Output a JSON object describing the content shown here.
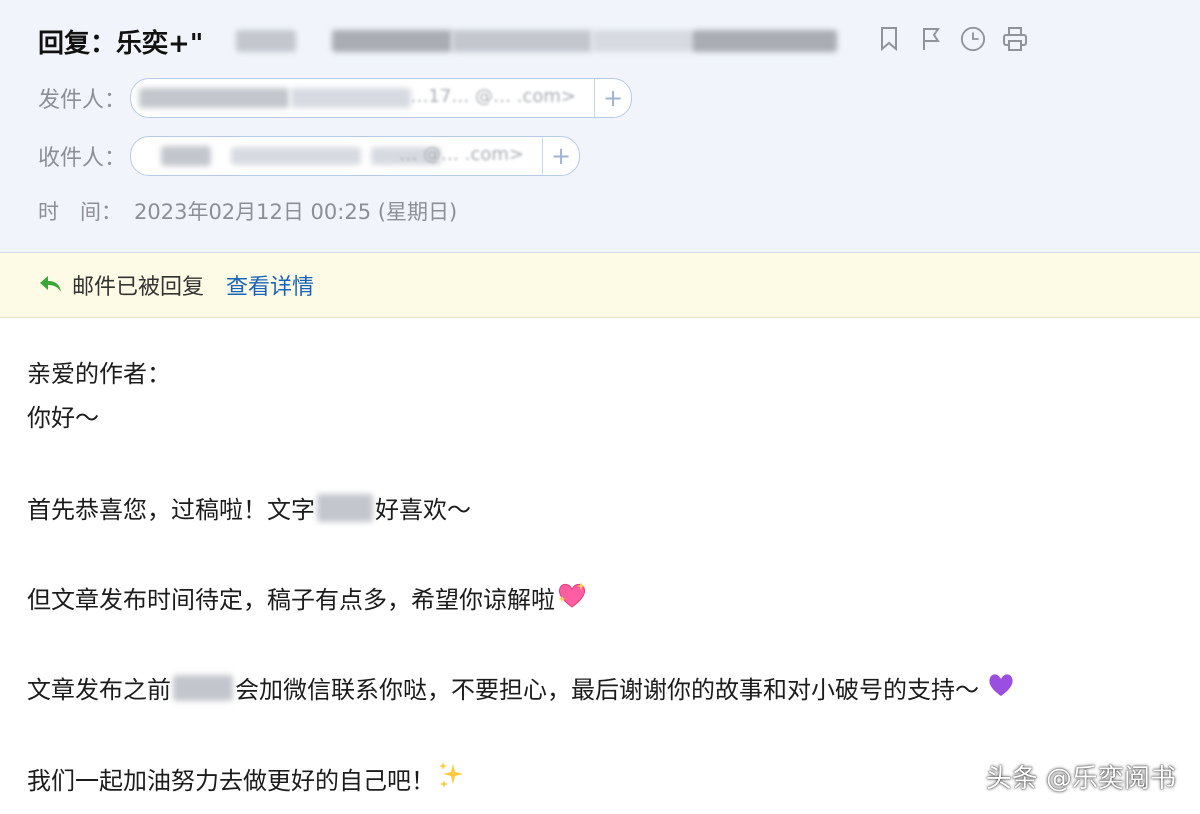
{
  "subject": {
    "prefix": "回复：乐奕+\""
  },
  "sender": {
    "label": "发件人：",
    "address_suffix": "…17… @… .com>"
  },
  "recipient": {
    "label": "收件人：",
    "address_suffix": "… @… .com>"
  },
  "add_symbol": "+",
  "time": {
    "label": "时　间：",
    "value": "2023年02月12日 00:25 (星期日)"
  },
  "actions": {
    "icons": [
      "bookmark-icon",
      "flag-icon",
      "clock-icon",
      "print-icon"
    ]
  },
  "replied_bar": {
    "status": "邮件已被回复",
    "details_link": "查看详情"
  },
  "body": {
    "greeting": "亲爱的作者：",
    "hello": "你好～",
    "p1_a": "首先恭喜您，过稿啦！文字",
    "p1_b": "好喜欢～",
    "p2": "但文章发布时间待定，稿子有点多，希望你谅解啦",
    "p3_a": "文章发布之前",
    "p3_b": "会加微信联系你哒，不要担心，最后谢谢你的故事和对小破号的支持～",
    "p4": "我们一起加油努力去做更好的自己吧！"
  },
  "watermark": "头条 @乐奕阅书",
  "colors": {
    "header_bg": "#f1f5fb",
    "replied_bg": "#fdfbe6",
    "link": "#1a63b8",
    "reply_arrow": "#3aa63a"
  }
}
